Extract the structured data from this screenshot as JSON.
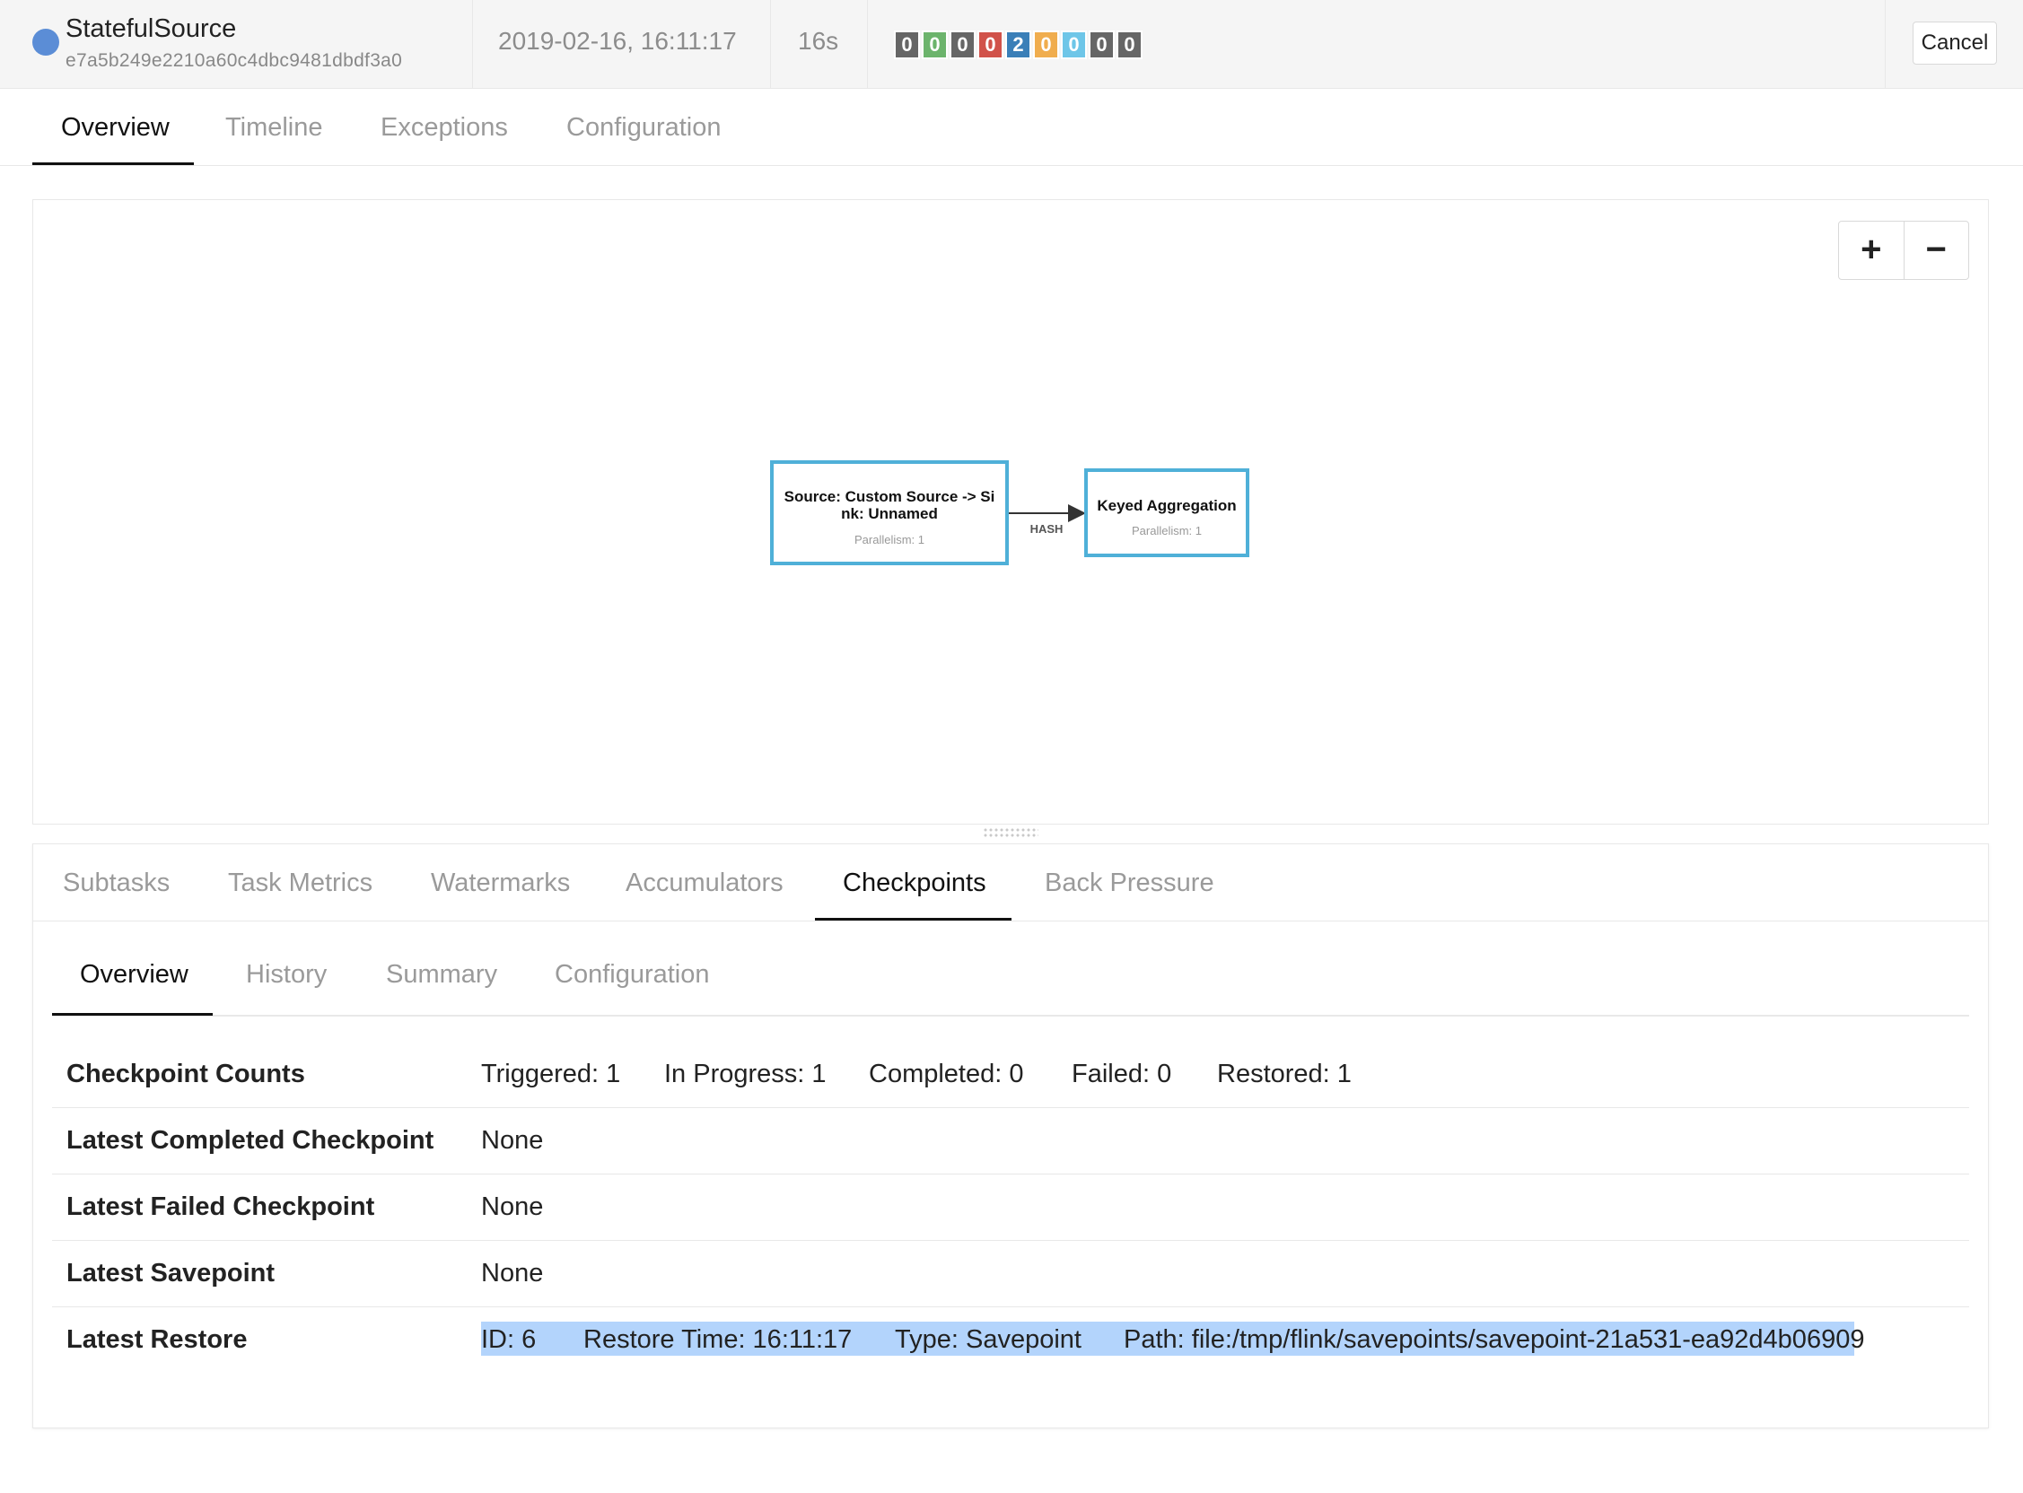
{
  "job": {
    "name": "StatefulSource",
    "id": "e7a5b249e2210a60c4dbc9481dbdf3a0",
    "start_time": "2019-02-16, 16:11:17",
    "duration": "16s",
    "status_color": "#5b8dd6",
    "task_counts": [
      {
        "value": "0",
        "color": "#666666"
      },
      {
        "value": "0",
        "color": "#6cb46c"
      },
      {
        "value": "0",
        "color": "#666666"
      },
      {
        "value": "0",
        "color": "#d1524a"
      },
      {
        "value": "2",
        "color": "#3a7fb8"
      },
      {
        "value": "0",
        "color": "#f0ad4e"
      },
      {
        "value": "0",
        "color": "#6ec6e8"
      },
      {
        "value": "0",
        "color": "#666666"
      },
      {
        "value": "0",
        "color": "#666666"
      }
    ],
    "cancel_label": "Cancel"
  },
  "main_tabs": [
    "Overview",
    "Timeline",
    "Exceptions",
    "Configuration"
  ],
  "graph": {
    "node_border_color": "#4fb0d8",
    "nodes": [
      {
        "title_line1": "Source: Custom Source -> Si",
        "title_line2": "nk: Unnamed",
        "parallelism": "Parallelism: 1"
      },
      {
        "title_line1": "Keyed Aggregation",
        "parallelism": "Parallelism: 1"
      }
    ],
    "edge_label": "HASH",
    "zoom_in": "+",
    "zoom_out": "−"
  },
  "vertex_tabs": [
    "Subtasks",
    "Task Metrics",
    "Watermarks",
    "Accumulators",
    "Checkpoints",
    "Back Pressure"
  ],
  "checkpoint_tabs": [
    "Overview",
    "History",
    "Summary",
    "Configuration"
  ],
  "checkpoint_overview": {
    "counts_label": "Checkpoint Counts",
    "counts": {
      "triggered": "Triggered: 1",
      "in_progress": "In Progress: 1",
      "completed": "Completed: 0",
      "failed": "Failed: 0",
      "restored": "Restored: 1"
    },
    "latest_completed": {
      "label": "Latest Completed Checkpoint",
      "value": "None"
    },
    "latest_failed": {
      "label": "Latest Failed Checkpoint",
      "value": "None"
    },
    "latest_savepoint": {
      "label": "Latest Savepoint",
      "value": "None"
    },
    "latest_restore": {
      "label": "Latest Restore",
      "id": "ID: 6",
      "restore_time": "Restore Time: 16:11:17",
      "type": "Type: Savepoint",
      "path": "Path: file:/tmp/flink/savepoints/savepoint-21a531-ea92d4b06909"
    }
  }
}
